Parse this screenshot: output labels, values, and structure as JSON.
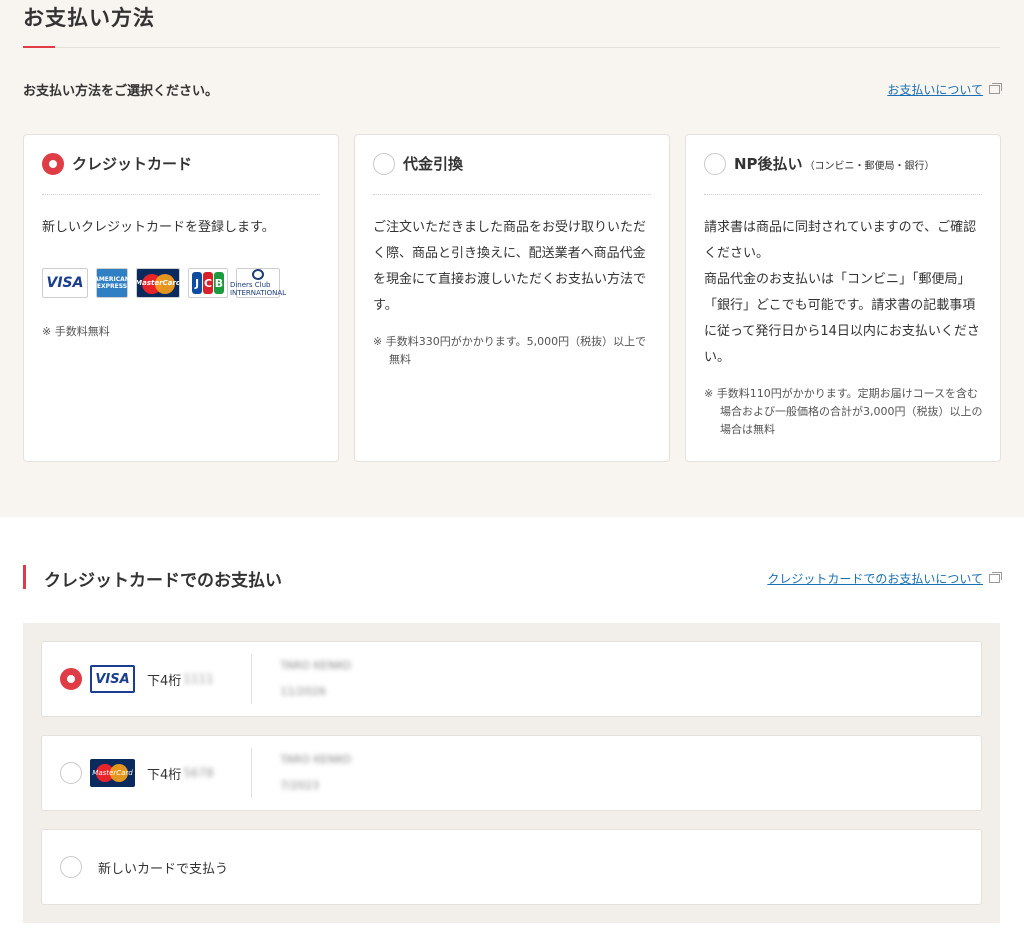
{
  "header": {
    "title": "お支払い方法",
    "prompt": "お支払い方法をご選択ください。",
    "help_link": "お支払いについて"
  },
  "methods": [
    {
      "title": "クレジットカード",
      "selected": true,
      "description": "新しいクレジットカードを登録します。",
      "logos": [
        "VISA",
        "AMERICAN EXPRESS",
        "MasterCard",
        "JCB",
        "Diners Club INTERNATIONAL"
      ],
      "note": "※ 手数料無料"
    },
    {
      "title": "代金引換",
      "selected": false,
      "description": "ご注文いただきました商品をお受け取りいただく際、商品と引き換えに、配送業者へ商品代金を現金にて直接お渡しいただくお支払い方法です。",
      "note": "※ 手数料330円がかかります。5,000円（税抜）以上で無料"
    },
    {
      "title": "NP後払い",
      "subtitle": "（コンビニ・郵便局・銀行）",
      "selected": false,
      "description_lines": [
        "請求書は商品に同封されていますので、ご確認ください。",
        "商品代金のお支払いは「コンビニ」「郵便局」「銀行」どこでも可能です。請求書の記載事項に従って発行日から14日以内にお支払いください。"
      ],
      "note": "※ 手数料110円がかかります。定期お届けコースを含む場合および一般価格の合計が3,000円（税抜）以上の場合は無料"
    }
  ],
  "credit_section": {
    "title": "クレジットカードでのお支払い",
    "help_link": "クレジットカードでのお支払いについて",
    "saved_cards": [
      {
        "brand": "VISA",
        "last4_label": "下4桁",
        "last4": "1111",
        "holder": "TARO KENKO",
        "expiry": "11/2026",
        "selected": true
      },
      {
        "brand": "MasterCard",
        "last4_label": "下4桁",
        "last4": "5678",
        "holder": "TARO KENKO",
        "expiry": "7/2023",
        "selected": false
      }
    ],
    "new_card_label": "新しいカードで支払う"
  },
  "colors": {
    "accent": "#e03c46",
    "link": "#1a6fb4",
    "top_bg": "#f8f5f1",
    "panel_bg": "#f2efeb"
  }
}
